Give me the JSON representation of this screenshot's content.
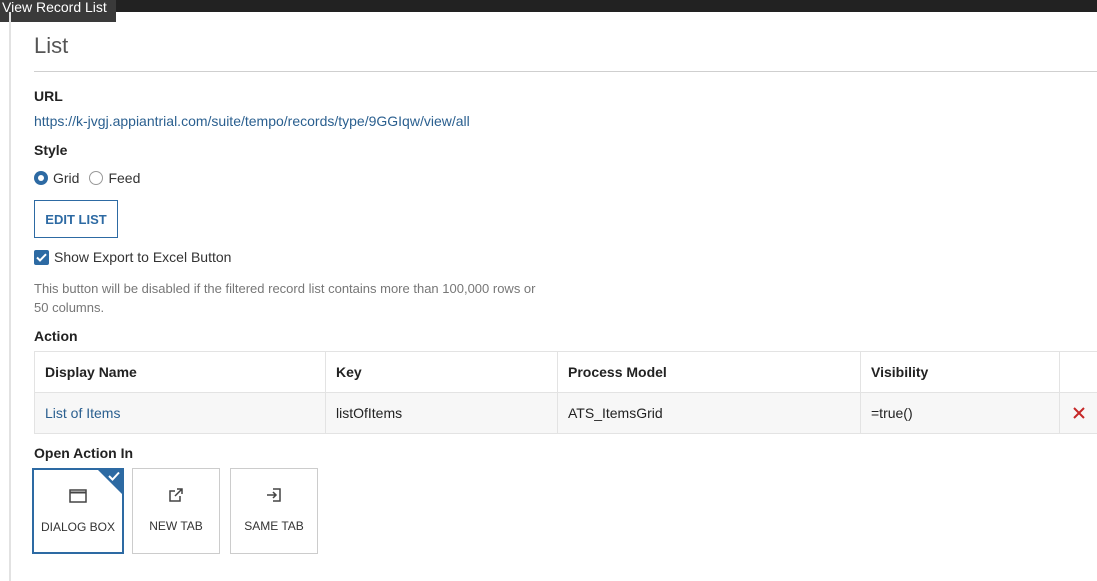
{
  "window": {
    "tab_title": "View Record List"
  },
  "page": {
    "title": "List"
  },
  "url_section": {
    "label": "URL",
    "value": "https://k-jvgj.appiantrial.com/suite/tempo/records/type/9GGIqw/view/all"
  },
  "style_section": {
    "label": "Style",
    "options": [
      {
        "label": "Grid",
        "selected": true
      },
      {
        "label": "Feed",
        "selected": false
      }
    ]
  },
  "edit_list_button": {
    "label": "EDIT LIST"
  },
  "export_option": {
    "label": "Show Export to Excel Button",
    "checked": true,
    "helper": "This button will be disabled if the filtered record list contains more than 100,000 rows or 50 columns."
  },
  "action_section": {
    "label": "Action",
    "columns": [
      "Display Name",
      "Key",
      "Process Model",
      "Visibility"
    ],
    "rows": [
      {
        "display_name": "List of Items",
        "key": "listOfItems",
        "process_model": "ATS_ItemsGrid",
        "visibility": "=true()"
      }
    ]
  },
  "open_action_section": {
    "label": "Open Action In",
    "options": [
      {
        "label": "DIALOG BOX",
        "icon": "dialog-box-icon",
        "selected": true
      },
      {
        "label": "NEW TAB",
        "icon": "new-tab-icon",
        "selected": false
      },
      {
        "label": "SAME TAB",
        "icon": "same-tab-icon",
        "selected": false
      }
    ]
  },
  "colors": {
    "accent": "#2d6aa3",
    "link": "#2a5f8f",
    "delete": "#c62828",
    "topbar": "#222222"
  }
}
